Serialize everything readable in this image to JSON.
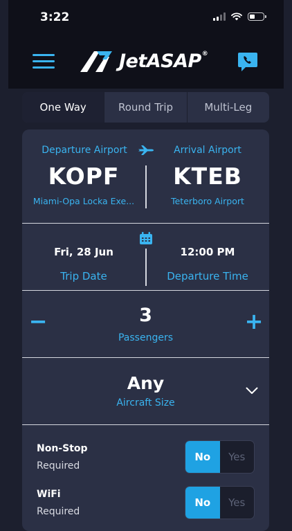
{
  "status_bar": {
    "time": "3:22"
  },
  "header": {
    "logo_text": "JetASAP"
  },
  "trip_tabs": [
    {
      "label": "One Way",
      "active": true
    },
    {
      "label": "Round Trip",
      "active": false
    },
    {
      "label": "Multi-Leg",
      "active": false
    }
  ],
  "route": {
    "departure_label": "Departure Airport",
    "departure_code": "KOPF",
    "departure_name": "Miami-Opa Locka Exe...",
    "arrival_label": "Arrival Airport",
    "arrival_code": "KTEB",
    "arrival_name": "Teterboro Airport"
  },
  "schedule": {
    "date_value": "Fri, 28 Jun",
    "date_label": "Trip Date",
    "time_value": "12:00 PM",
    "time_label": "Departure Time"
  },
  "passengers": {
    "count": "3",
    "label": "Passengers",
    "minus": "−",
    "plus": "+"
  },
  "aircraft": {
    "value": "Any",
    "label": "Aircraft Size"
  },
  "options": [
    {
      "name": "Non-Stop",
      "sub": "Required",
      "no": "No",
      "yes": "Yes",
      "selected": "No"
    },
    {
      "name": "WiFi",
      "sub": "Required",
      "no": "No",
      "yes": "Yes",
      "selected": "No"
    }
  ],
  "colors": {
    "accent": "#3ab4f0",
    "toggle_on": "#1fa2e3",
    "card": "#2b3045",
    "background": "#1c1f2e"
  },
  "icons": [
    "menu-icon",
    "jetasap-logo-icon",
    "phone-chat-icon",
    "airplane-icon",
    "calendar-icon",
    "chevron-down-icon"
  ]
}
